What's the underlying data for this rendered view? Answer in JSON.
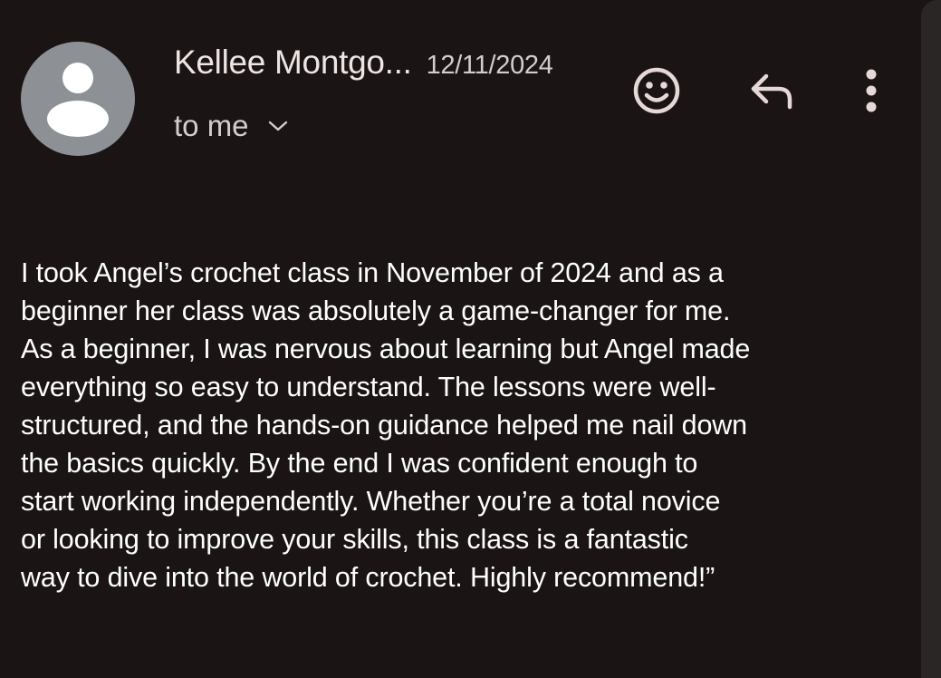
{
  "header": {
    "sender_name": "Kellee Montgo...",
    "date": "12/11/2024",
    "recipient_label": "to me"
  },
  "icons": {
    "avatar": "default-person-avatar",
    "recipient_toggle": "chevron-down-icon",
    "react": "smiley-icon",
    "reply": "reply-arrow-icon",
    "more": "more-vertical-icon"
  },
  "message": {
    "body": "I took Angel’s crochet class in November of 2024 and as a\nbeginner her class was absolutely a game-changer for me.\nAs a beginner, I was nervous about learning but Angel made\neverything so easy to understand. The lessons were well-\nstructured, and the hands-on guidance helped me nail down\nthe basics quickly. By the end I was confident enough to\nstart working independently.  Whether you’re a total novice\nor looking to improve your skills, this class is a fantastic\nway to dive into the world of crochet. Highly recommend!”"
  },
  "colors": {
    "background": "#1a1414",
    "avatar": "#8d9196",
    "name_text": "#eee5e3",
    "secondary_text": "#d6cccb",
    "icon": "#e6d8d7",
    "body_text": "#ffffff"
  }
}
